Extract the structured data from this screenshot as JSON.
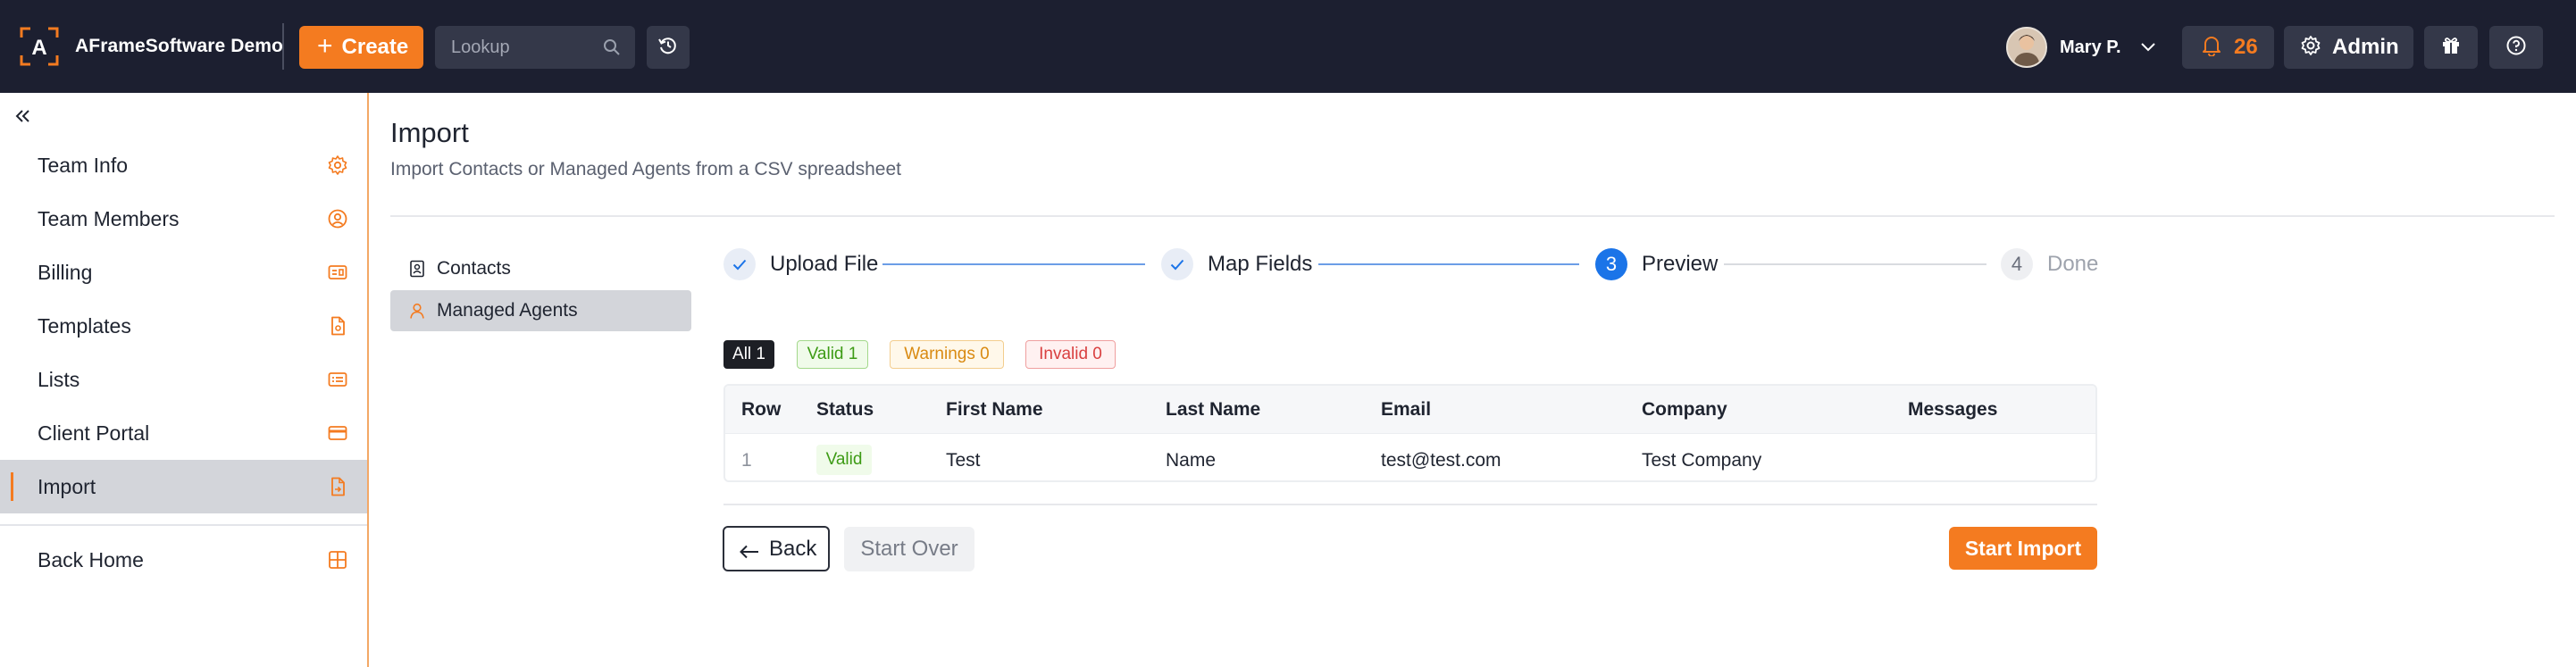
{
  "header": {
    "brand_name": "AFrameSoftware Demo",
    "create_label": "Create",
    "lookup_placeholder": "Lookup",
    "user_name": "Mary P.",
    "notification_count": "26",
    "admin_label": "Admin",
    "accent_color": "#f47b20",
    "bar_color": "#1c1f30",
    "icons": [
      "brand-logo-icon",
      "plus-icon",
      "search-icon",
      "history-icon",
      "chevron-down-icon",
      "bell-icon",
      "gear-icon",
      "gift-icon",
      "help-icon"
    ]
  },
  "sidebar": {
    "items": [
      {
        "label": "Team Info",
        "icon": "gear-icon"
      },
      {
        "label": "Team Members",
        "icon": "user-circle-icon"
      },
      {
        "label": "Billing",
        "icon": "billing-card-icon"
      },
      {
        "label": "Templates",
        "icon": "document-icon"
      },
      {
        "label": "Lists",
        "icon": "list-icon"
      },
      {
        "label": "Client Portal",
        "icon": "portal-card-icon"
      },
      {
        "label": "Import",
        "icon": "import-file-icon",
        "active": true
      }
    ],
    "back_home": {
      "label": "Back Home",
      "icon": "grid-icon"
    }
  },
  "main": {
    "title": "Import",
    "subtitle": "Import Contacts or Managed Agents from a CSV spreadsheet",
    "sub_nav": [
      {
        "label": "Contacts",
        "icon": "contact-card-icon"
      },
      {
        "label": "Managed Agents",
        "icon": "agent-user-icon",
        "active": true
      }
    ],
    "steps": [
      {
        "number": "1",
        "label": "Upload File",
        "state": "done"
      },
      {
        "number": "2",
        "label": "Map Fields",
        "state": "done"
      },
      {
        "number": "3",
        "label": "Preview",
        "state": "current"
      },
      {
        "number": "4",
        "label": "Done",
        "state": "todo"
      }
    ],
    "filters": {
      "all": "All 1",
      "valid": "Valid 1",
      "warnings": "Warnings 0",
      "invalid": "Invalid 0"
    },
    "table": {
      "columns": [
        "Row",
        "Status",
        "First Name",
        "Last Name",
        "Email",
        "Company",
        "Messages"
      ],
      "rows": [
        {
          "row": "1",
          "status": "Valid",
          "first_name": "Test",
          "last_name": "Name",
          "email": "test@test.com",
          "company": "Test Company",
          "messages": ""
        }
      ]
    },
    "actions": {
      "back": "Back",
      "start_over": "Start Over",
      "start_import": "Start Import"
    }
  }
}
